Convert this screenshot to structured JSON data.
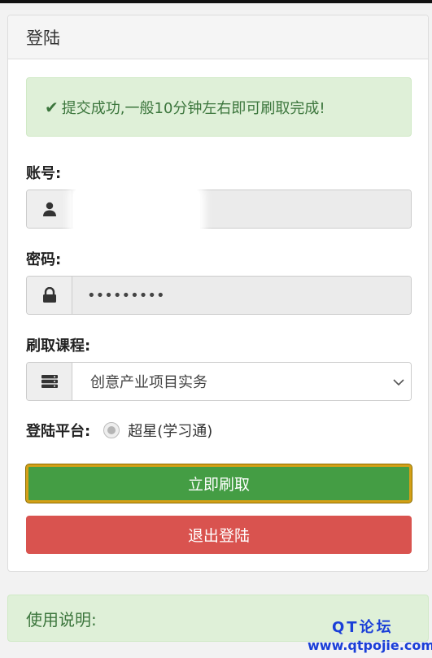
{
  "panel": {
    "title": "登陆"
  },
  "alert": {
    "icon": "check-icon",
    "message": "提交成功,一般10分钟左右即可刷取完成!"
  },
  "account": {
    "label": "账号:",
    "icon": "user-icon",
    "value": ""
  },
  "password": {
    "label": "密码:",
    "icon": "lock-icon",
    "value": "•••••••••"
  },
  "course": {
    "label": "刷取课程:",
    "icon": "server-icon",
    "selected": "创意产业项目实务"
  },
  "platform": {
    "label": "登陆平台:",
    "option": "超星(学习通)"
  },
  "buttons": {
    "submit": "立即刷取",
    "logout": "退出登陆"
  },
  "help": {
    "title": "使用说明:"
  },
  "watermark": {
    "line1": "QT论坛",
    "line2": "www.qtpojie.com"
  },
  "colors": {
    "success_bg": "#dff0d8",
    "success_text": "#3c763d",
    "btn_green": "#449d44",
    "btn_red": "#d9534f"
  }
}
